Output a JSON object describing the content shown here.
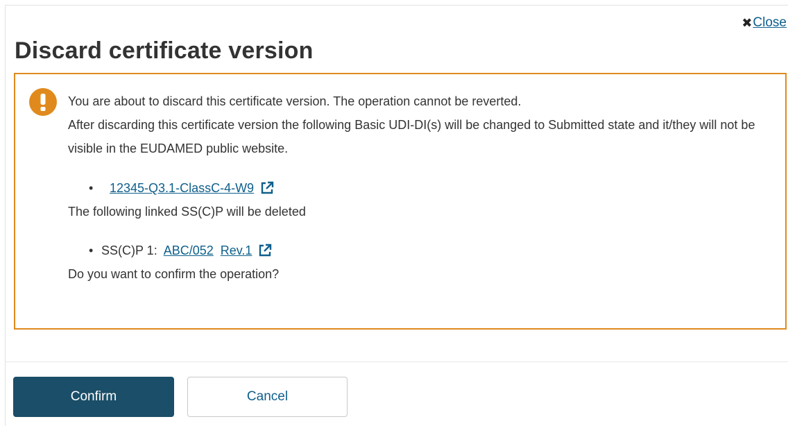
{
  "dialog": {
    "close_label": "Close",
    "title": "Discard certificate version"
  },
  "alert": {
    "icon": "warning-exclamation-icon",
    "line1": "You are about to discard this certificate version. The operation cannot be reverted.",
    "line2": "After discarding this certificate version the following Basic UDI-DI(s) will be changed to Submitted state and it/they will not be visible in the EUDAMED public website.",
    "udi_items": [
      {
        "link_text": "12345-Q3.1-ClassC-4-W9"
      }
    ],
    "sscp_heading": "The following linked SS(C)P will be deleted",
    "sscp_items": [
      {
        "prefix": "SS(C)P 1:",
        "link_text": "ABC/052",
        "rev_text": "Rev.1"
      }
    ],
    "confirm_question": "Do you want to confirm the operation?"
  },
  "footer": {
    "confirm_label": "Confirm",
    "cancel_label": "Cancel"
  },
  "colors": {
    "alert_border": "#e08a1d",
    "primary_button": "#1b4e68",
    "link": "#0e5f8c"
  }
}
